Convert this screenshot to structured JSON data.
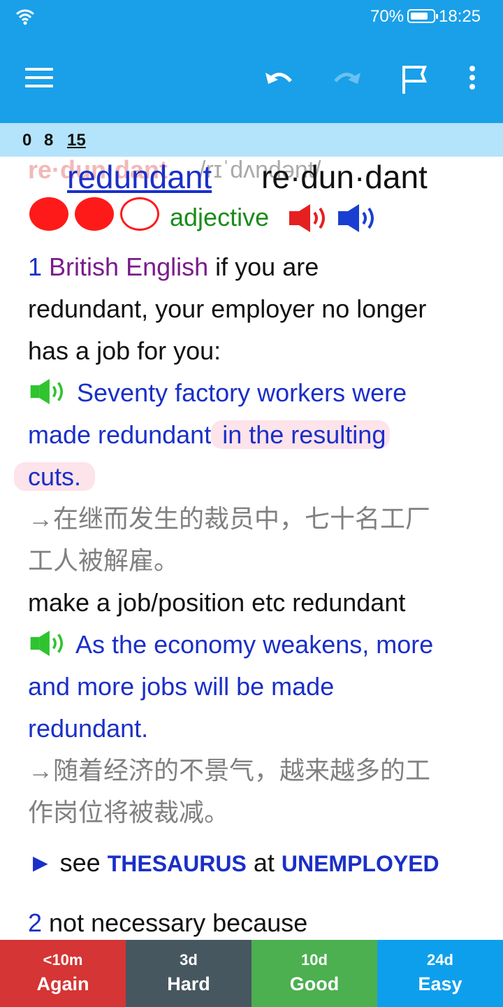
{
  "status_bar": {
    "battery": "70%",
    "time": "18:25"
  },
  "counts": {
    "new": "0",
    "learning": "8",
    "review": "15"
  },
  "entry": {
    "ghost_word": "re·dun·dant",
    "ghost_pron": "/rɪˈdʌndənt/",
    "headword": "redundant",
    "syllabified": "re·dun·dant",
    "pos": "adjective",
    "sense1": {
      "number": "1",
      "region": "British English",
      "def_line1": " if you are",
      "def_line2": "redundant, your employer no longer",
      "def_line3": "has a job for you:",
      "ex1_line1": "Seventy factory workers were",
      "ex1_line2a": "made redundant",
      "ex1_line2b": " in the resulting",
      "ex1_line3": "cuts.",
      "zh1_line1": "→在继而发生的裁员中，七十名工厂",
      "zh1_line2": "工人被解雇。",
      "phrase": "make a job/position etc redundant",
      "ex2_line1": "As the economy weakens, more",
      "ex2_line2": "and more jobs will be made",
      "ex2_line3": "redundant.",
      "zh2_line1": "→随着经济的不景气，越来越多的工",
      "zh2_line2": "作岗位将被裁减。",
      "see_arrow": "►",
      "see": " see ",
      "thesaurus": "THESAURUS",
      "at": " at ",
      "unemployed": "UNEMPLOYED"
    },
    "sense2": {
      "number": "2",
      "def": " not necessary because"
    }
  },
  "answers": [
    {
      "interval": "<10m",
      "label": "Again",
      "color": "#d53534"
    },
    {
      "interval": "3d",
      "label": "Hard",
      "color": "#475760"
    },
    {
      "interval": "10d",
      "label": "Good",
      "color": "#4caf50"
    },
    {
      "interval": "24d",
      "label": "Easy",
      "color": "#0e9fec"
    }
  ],
  "colors": {
    "app_bar": "#1aa0e8",
    "counts_bar": "#b3e4fb",
    "link": "#1a2fc8",
    "pos": "#1a8c1a"
  },
  "icons": [
    "wifi-icon",
    "battery-icon",
    "menu-icon",
    "undo-icon",
    "redo-icon",
    "flag-icon",
    "more-icon",
    "speaker-icon"
  ]
}
